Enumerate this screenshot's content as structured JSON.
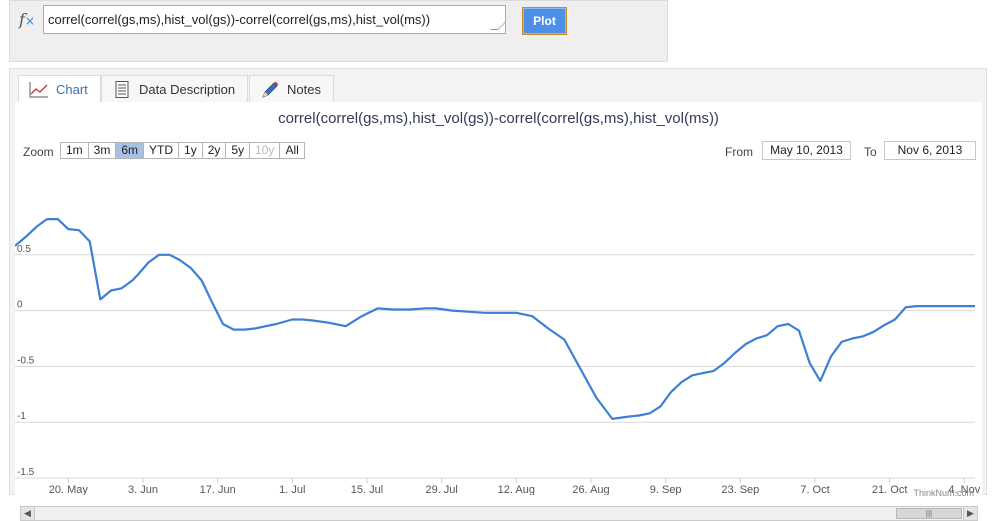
{
  "formula": {
    "value": "correl(correl(gs,ms),hist_vol(gs))-correl(correl(gs,ms),hist_vol(ms))",
    "plot_label": "Plot"
  },
  "tabs": [
    {
      "label": "Chart",
      "icon": "line-chart-icon"
    },
    {
      "label": "Data Description",
      "icon": "document-icon"
    },
    {
      "label": "Notes",
      "icon": "pencil-icon"
    }
  ],
  "zoom": {
    "label": "Zoom",
    "buttons": [
      {
        "label": "1m",
        "state": "normal"
      },
      {
        "label": "3m",
        "state": "normal"
      },
      {
        "label": "6m",
        "state": "active"
      },
      {
        "label": "YTD",
        "state": "normal"
      },
      {
        "label": "1y",
        "state": "normal"
      },
      {
        "label": "2y",
        "state": "normal"
      },
      {
        "label": "5y",
        "state": "normal"
      },
      {
        "label": "10y",
        "state": "disabled"
      },
      {
        "label": "All",
        "state": "normal"
      }
    ]
  },
  "range": {
    "from_label": "From",
    "from": "May 10, 2013",
    "to_label": "To",
    "to": "Nov 6, 2013"
  },
  "credit": "ThinkNum.com",
  "colors": {
    "line": "#3d7fd6",
    "grid": "#d8d8d8",
    "active_zoom": "#a9c0e6",
    "plot_button": "#4d8fe6"
  },
  "chart_data": {
    "type": "line",
    "title": "correl(correl(gs,ms),hist_vol(gs))-correl(correl(gs,ms),hist_vol(ms))",
    "xlabel": "",
    "ylabel": "",
    "xlim": [
      "2013-05-10",
      "2013-11-06"
    ],
    "ylim": [
      -1.5,
      1.0
    ],
    "yticks": [
      -1.5,
      -1,
      -0.5,
      0,
      0.5
    ],
    "ytick_labels": [
      "-1.5",
      "-1",
      "-0.5",
      "0",
      "0.5"
    ],
    "xticks": [
      {
        "date": "2013-05-20",
        "label": "20. May"
      },
      {
        "date": "2013-06-03",
        "label": "3. Jun"
      },
      {
        "date": "2013-06-17",
        "label": "17. Jun"
      },
      {
        "date": "2013-07-01",
        "label": "1. Jul"
      },
      {
        "date": "2013-07-15",
        "label": "15. Jul"
      },
      {
        "date": "2013-07-29",
        "label": "29. Jul"
      },
      {
        "date": "2013-08-12",
        "label": "12. Aug"
      },
      {
        "date": "2013-08-26",
        "label": "26. Aug"
      },
      {
        "date": "2013-09-09",
        "label": "9. Sep"
      },
      {
        "date": "2013-09-23",
        "label": "23. Sep"
      },
      {
        "date": "2013-10-07",
        "label": "7. Oct"
      },
      {
        "date": "2013-10-21",
        "label": "21. Oct"
      },
      {
        "date": "2013-11-04",
        "label": "4. Nov"
      }
    ],
    "grid": true,
    "series": [
      {
        "x": [
          "2013-05-10",
          "2013-05-12",
          "2013-05-14",
          "2013-05-16",
          "2013-05-18",
          "2013-05-20",
          "2013-05-22",
          "2013-05-24",
          "2013-05-26",
          "2013-05-28",
          "2013-05-30",
          "2013-06-01",
          "2013-06-02",
          "2013-06-04",
          "2013-06-06",
          "2013-06-08",
          "2013-06-10",
          "2013-06-12",
          "2013-06-14",
          "2013-06-16",
          "2013-06-18",
          "2013-06-20",
          "2013-06-22",
          "2013-06-24",
          "2013-06-26",
          "2013-06-28",
          "2013-07-01",
          "2013-07-03",
          "2013-07-05",
          "2013-07-08",
          "2013-07-11",
          "2013-07-14",
          "2013-07-17",
          "2013-07-20",
          "2013-07-23",
          "2013-07-26",
          "2013-07-28",
          "2013-07-31",
          "2013-08-03",
          "2013-08-06",
          "2013-08-09",
          "2013-08-12",
          "2013-08-15",
          "2013-08-18",
          "2013-08-21",
          "2013-08-24",
          "2013-08-27",
          "2013-08-30",
          "2013-09-02",
          "2013-09-04",
          "2013-09-06",
          "2013-09-08",
          "2013-09-10",
          "2013-09-12",
          "2013-09-14",
          "2013-09-16",
          "2013-09-18",
          "2013-09-20",
          "2013-09-22",
          "2013-09-24",
          "2013-09-26",
          "2013-09-28",
          "2013-09-30",
          "2013-10-02",
          "2013-10-04",
          "2013-10-06",
          "2013-10-08",
          "2013-10-10",
          "2013-10-12",
          "2013-10-14",
          "2013-10-16",
          "2013-10-18",
          "2013-10-20",
          "2013-10-22",
          "2013-10-24",
          "2013-10-26",
          "2013-10-28",
          "2013-10-30",
          "2013-11-01",
          "2013-11-03",
          "2013-11-05",
          "2013-11-06"
        ],
        "y": [
          0.58,
          0.66,
          0.75,
          0.82,
          0.82,
          0.73,
          0.72,
          0.62,
          0.1,
          0.18,
          0.2,
          0.27,
          0.32,
          0.43,
          0.5,
          0.5,
          0.45,
          0.38,
          0.27,
          0.07,
          -0.12,
          -0.17,
          -0.17,
          -0.16,
          -0.14,
          -0.12,
          -0.08,
          -0.08,
          -0.09,
          -0.11,
          -0.14,
          -0.05,
          0.02,
          0.01,
          0.01,
          0.02,
          0.02,
          0.0,
          -0.01,
          -0.02,
          -0.02,
          -0.02,
          -0.05,
          -0.16,
          -0.26,
          -0.52,
          -0.78,
          -0.97,
          -0.95,
          -0.94,
          -0.92,
          -0.86,
          -0.73,
          -0.64,
          -0.58,
          -0.56,
          -0.54,
          -0.47,
          -0.38,
          -0.3,
          -0.25,
          -0.22,
          -0.14,
          -0.12,
          -0.18,
          -0.47,
          -0.63,
          -0.41,
          -0.28,
          -0.25,
          -0.23,
          -0.19,
          -0.13,
          -0.08,
          0.03,
          0.04,
          0.04,
          0.04,
          0.04,
          0.04,
          0.04,
          0.04
        ]
      }
    ]
  }
}
